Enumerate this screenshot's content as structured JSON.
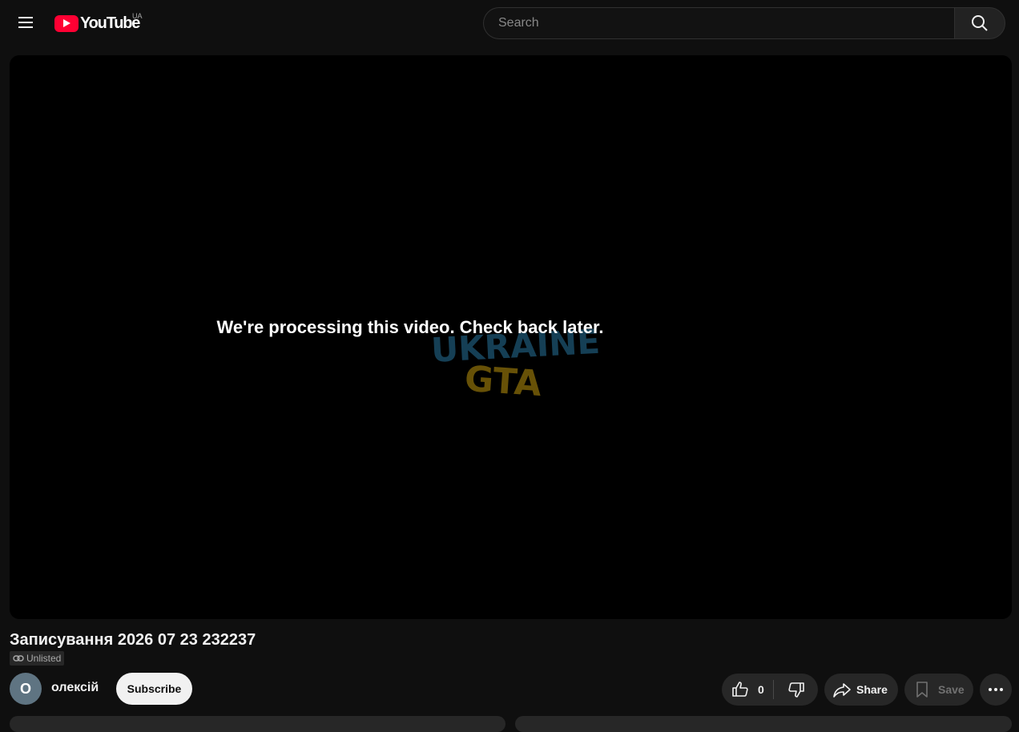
{
  "header": {
    "menu_icon": "hamburger-menu-icon",
    "logo_text": "YouTube",
    "country_code": "UA",
    "search_placeholder": "Search",
    "search_icon": "search-icon"
  },
  "player": {
    "message": "We're processing this video. Check back later.",
    "watermark_line1": "UKRAINE",
    "watermark_line2": "GTA"
  },
  "video": {
    "title": "Записування 2026 07 23 232237",
    "visibility_badge": "Unlisted",
    "visibility_icon": "link-icon"
  },
  "channel": {
    "avatar_letter": "О",
    "name": "олексій",
    "subscribe_label": "Subscribe"
  },
  "actions": {
    "like_count": "0",
    "like_icon": "thumbs-up-icon",
    "dislike_icon": "thumbs-down-icon",
    "share_label": "Share",
    "share_icon": "share-arrow-icon",
    "save_label": "Save",
    "save_icon": "bookmark-icon",
    "more_icon": "more-horizontal-icon"
  },
  "colors": {
    "background": "#0f0f0f",
    "brand_red": "#ff0033",
    "button_bg": "#272727",
    "subscribe_bg": "#f1f1f1",
    "watermark_blue": "#1f5a7a",
    "watermark_yellow": "#8a6d0a"
  }
}
